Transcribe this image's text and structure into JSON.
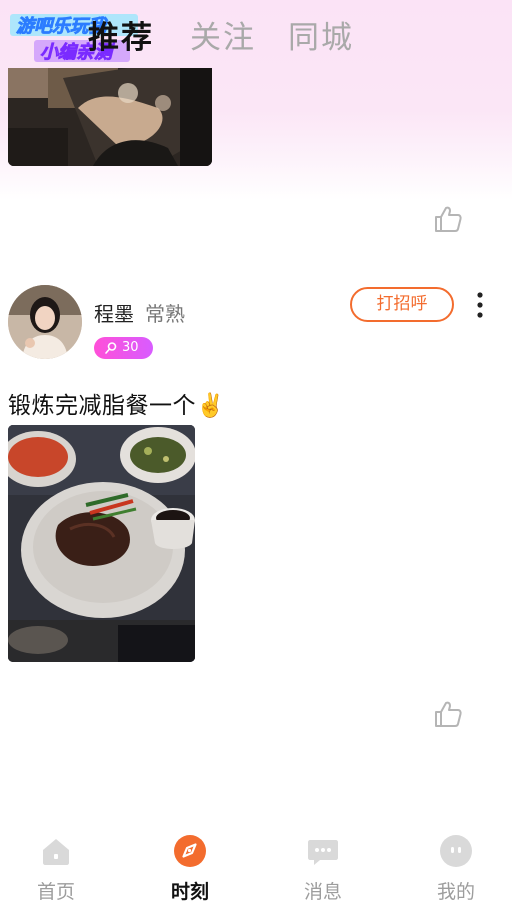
{
  "header": {
    "tabs": [
      {
        "label": "推荐",
        "active": true
      },
      {
        "label": "关注",
        "active": false
      },
      {
        "label": "同城",
        "active": false
      }
    ],
    "watermark_line1": "游吧乐玩我",
    "watermark_line2": "小编亲测"
  },
  "post": {
    "user_name": "程墨",
    "user_city": "常熟",
    "badge_count": "30",
    "greet_label": "打招呼",
    "text": "锻炼完减脂餐一个✌️"
  },
  "bottom_nav": {
    "items": [
      {
        "label": "首页",
        "icon": "home-icon",
        "active": false
      },
      {
        "label": "时刻",
        "icon": "compass-icon",
        "active": true
      },
      {
        "label": "消息",
        "icon": "message-icon",
        "active": false
      },
      {
        "label": "我的",
        "icon": "profile-icon",
        "active": false
      }
    ]
  },
  "colors": {
    "accent_orange": "#f36c2e",
    "badge_pink": "#ff4fd8",
    "header_pink": "#fbe3f6",
    "inactive_gray": "#9d9d9d"
  }
}
